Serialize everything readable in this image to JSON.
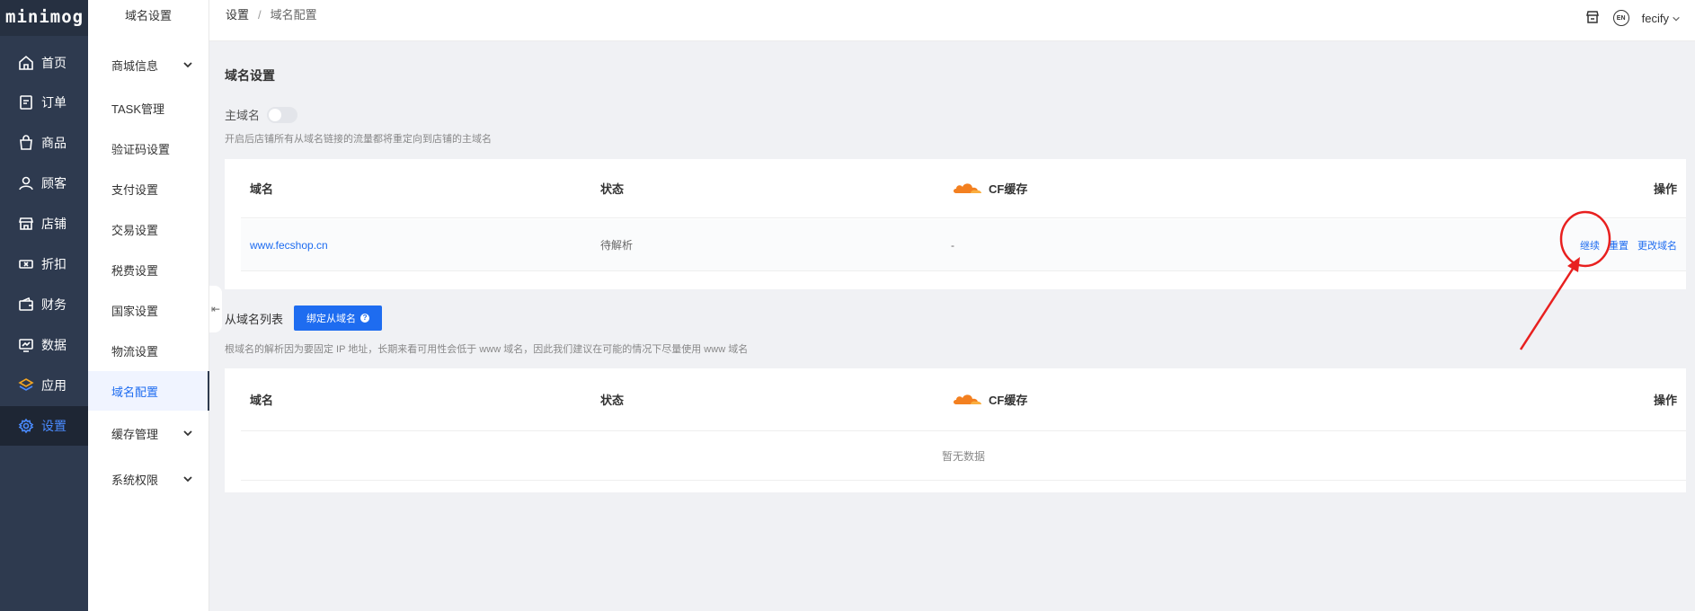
{
  "app": {
    "logo": "minimog"
  },
  "main_nav": [
    {
      "label": "首页",
      "icon": "home-icon"
    },
    {
      "label": "订单",
      "icon": "order-icon"
    },
    {
      "label": "商品",
      "icon": "bag-icon"
    },
    {
      "label": "顾客",
      "icon": "user-icon"
    },
    {
      "label": "店铺",
      "icon": "store-icon"
    },
    {
      "label": "折扣",
      "icon": "ticket-icon"
    },
    {
      "label": "财务",
      "icon": "wallet-icon"
    },
    {
      "label": "数据",
      "icon": "chart-icon"
    },
    {
      "label": "应用",
      "icon": "layers-icon"
    },
    {
      "label": "设置",
      "icon": "gear-icon",
      "active": true
    }
  ],
  "sub_nav": {
    "title": "域名设置",
    "items": [
      {
        "label": "商城信息",
        "expandable": true
      },
      {
        "label": "TASK管理"
      },
      {
        "label": "验证码设置"
      },
      {
        "label": "支付设置"
      },
      {
        "label": "交易设置"
      },
      {
        "label": "税费设置"
      },
      {
        "label": "国家设置"
      },
      {
        "label": "物流设置"
      },
      {
        "label": "域名配置",
        "active": true
      },
      {
        "label": "缓存管理",
        "expandable": true
      },
      {
        "label": "系统权限",
        "expandable": true
      }
    ]
  },
  "header": {
    "breadcrumb_root": "设置",
    "breadcrumb_sep": "/",
    "breadcrumb_current": "域名配置",
    "lang": "EN",
    "user": "fecify"
  },
  "domain_settings": {
    "title": "域名设置",
    "main_domain_label": "主域名",
    "main_domain_enabled": false,
    "main_domain_hint": "开启后店铺所有从域名链接的流量都将重定向到店铺的主域名"
  },
  "table_columns": {
    "domain": "域名",
    "status": "状态",
    "cf": "CF缓存",
    "ops": "操作"
  },
  "main_table": {
    "rows": [
      {
        "domain": "www.fecshop.cn",
        "status": "待解析",
        "cf": "-",
        "op_continue": "继续",
        "op_reset": "重置",
        "op_change": "更改域名"
      }
    ]
  },
  "sub_domains": {
    "label": "从域名列表",
    "bind_button": "绑定从域名",
    "hint": "根域名的解析因为要固定 IP 地址，长期来看可用性会低于 www 域名，因此我们建议在可能的情况下尽量使用 www 域名",
    "empty_text": "暂无数据"
  },
  "colors": {
    "sidebar_bg": "#2e3a4f",
    "accent": "#1e6cf0",
    "cloudflare": "#f38020",
    "annotation": "#e8201f"
  }
}
